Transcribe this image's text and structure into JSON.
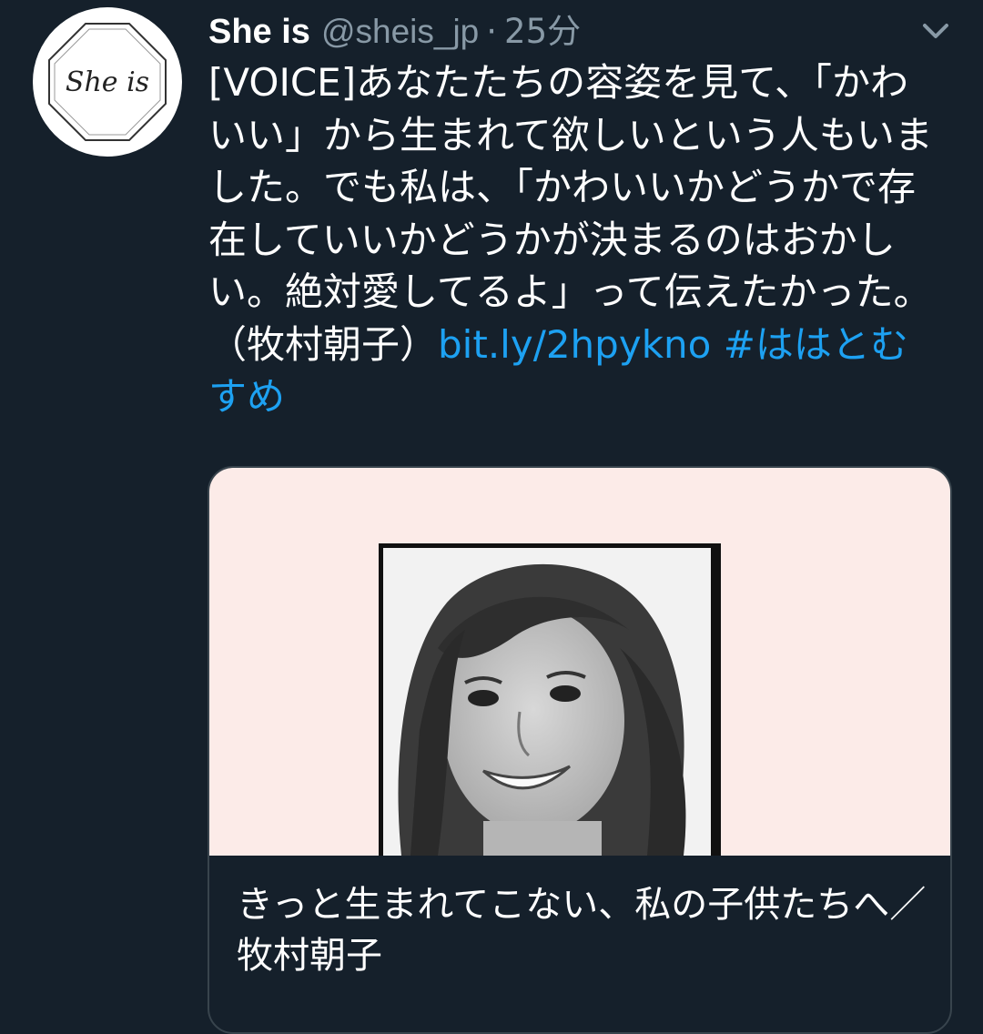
{
  "tweet": {
    "author_name": "She is",
    "author_handle": "@sheis_jp",
    "separator": "·",
    "timestamp": "25分",
    "avatar_logo_text": "She is",
    "text_main": "[VOICE]あなたたちの容姿を見て、「かわいい」から生まれて欲しいという人もいました。でも私は、「かわいいかどうかで存在していいかどうかが決まるのはおかしい。絶対愛してるよ」って伝えたかった。（牧村朝子）",
    "link_text": "bit.ly/2hpykno",
    "hashtag_text": "#ははとむすめ",
    "card_title": "きっと生まれてこない、私の子供たちへ／牧村朝子"
  },
  "icons": {
    "menu": "chevron-down-icon"
  },
  "colors": {
    "background": "#15202b",
    "link": "#1da1f2",
    "secondary_text": "#8899a6",
    "card_image_bg": "#fcebe8"
  }
}
